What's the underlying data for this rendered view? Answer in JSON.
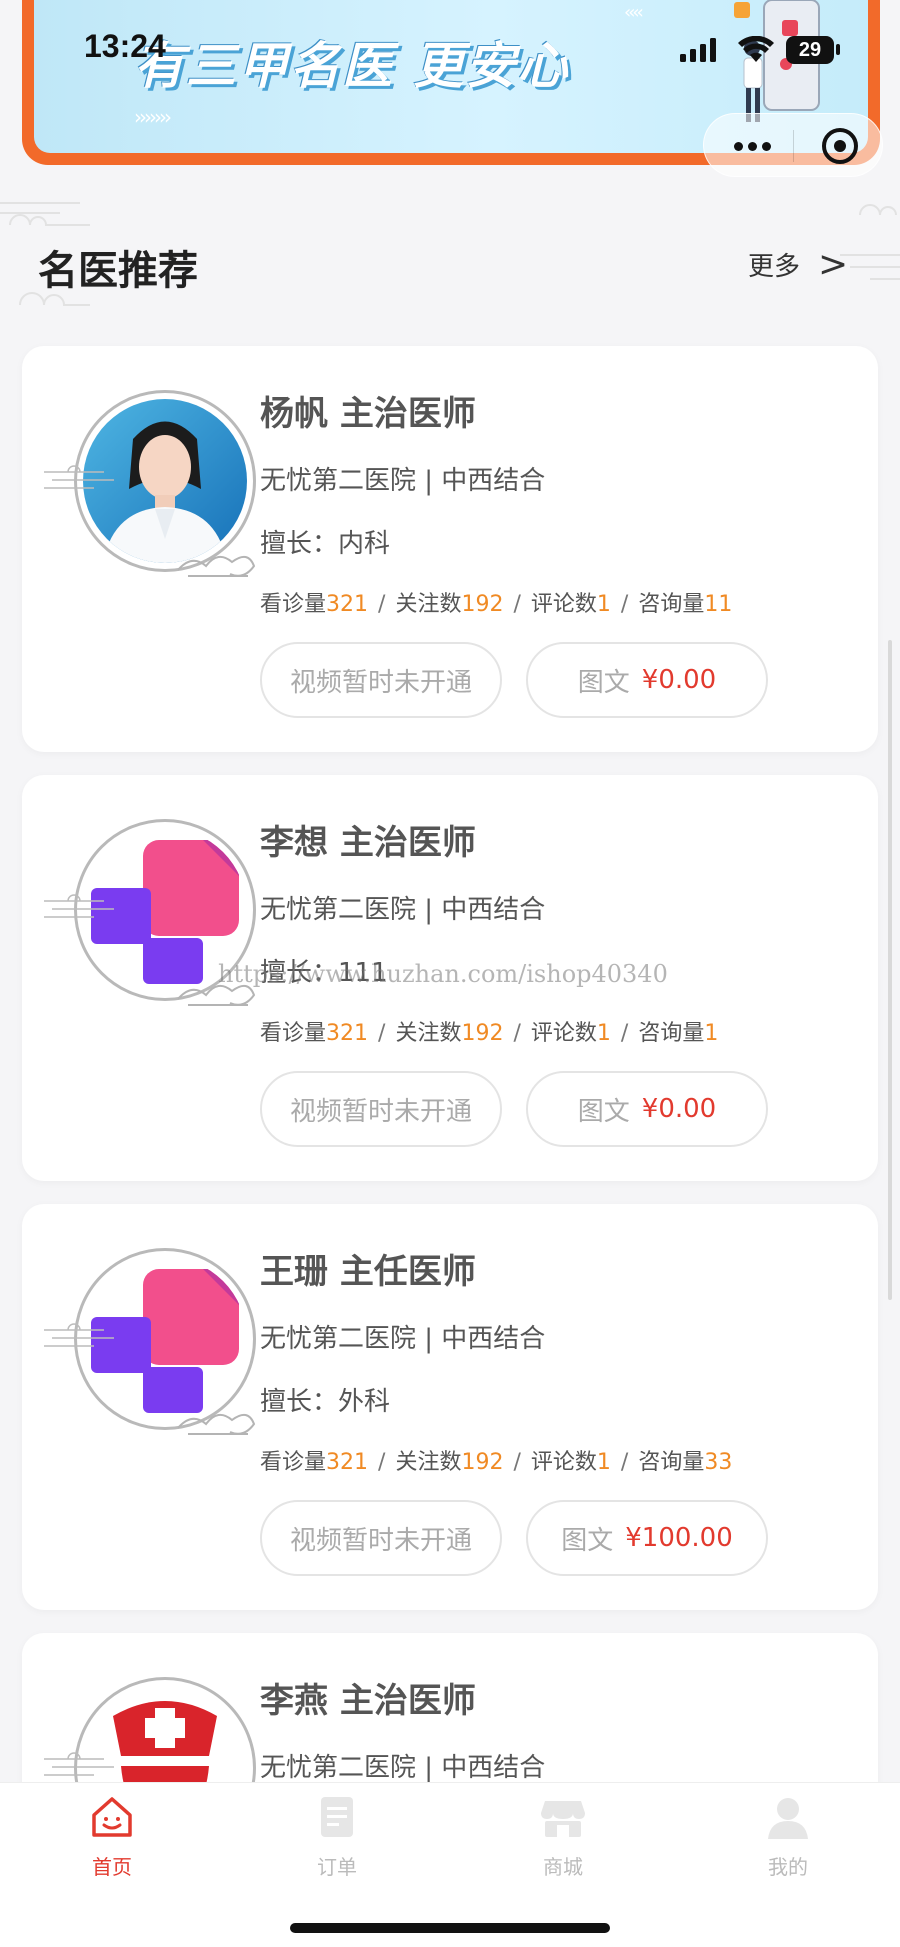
{
  "status_bar": {
    "time": "13:24",
    "battery": "29"
  },
  "banner": {
    "slogan": "有三甲名医 更安心",
    "chevrons": "›››››››",
    "chevrons_small": "‹‹‹‹"
  },
  "section": {
    "title": "名医推荐",
    "more_label": "更多",
    "more_icon": "chevron-right-icon"
  },
  "watermark": "https://www.huzhan.com/ishop40340",
  "colors": {
    "accent": "#e23a2e",
    "stat_number": "#f08a24",
    "banner_border": "#f26a2a"
  },
  "doctors": [
    {
      "name": "杨帆 主治医师",
      "hospital": "无忧第二医院 | 中西结合",
      "specialty": "擅长：内科",
      "stats": {
        "visits_label": "看诊量",
        "visits": "321",
        "follows_label": "关注数",
        "follows": "192",
        "reviews_label": "评论数",
        "reviews": "1",
        "consults_label": "咨询量",
        "consults": "11",
        "sep": "/"
      },
      "video_label": "视频暂时未开通",
      "text_label": "图文",
      "text_price": "¥0.00",
      "avatar": "doctor-photo"
    },
    {
      "name": "李想 主治医师",
      "hospital": "无忧第二医院 | 中西结合",
      "specialty": "擅长：111",
      "stats": {
        "visits_label": "看诊量",
        "visits": "321",
        "follows_label": "关注数",
        "follows": "192",
        "reviews_label": "评论数",
        "reviews": "1",
        "consults_label": "咨询量",
        "consults": "1",
        "sep": "/"
      },
      "video_label": "视频暂时未开通",
      "text_label": "图文",
      "text_price": "¥0.00",
      "avatar": "medical-cross-logo"
    },
    {
      "name": "王珊 主任医师",
      "hospital": "无忧第二医院 | 中西结合",
      "specialty": "擅长：外科",
      "stats": {
        "visits_label": "看诊量",
        "visits": "321",
        "follows_label": "关注数",
        "follows": "192",
        "reviews_label": "评论数",
        "reviews": "1",
        "consults_label": "咨询量",
        "consults": "33",
        "sep": "/"
      },
      "video_label": "视频暂时未开通",
      "text_label": "图文",
      "text_price": "¥100.00",
      "avatar": "medical-cross-logo"
    },
    {
      "name": "李燕 主治医师",
      "hospital": "无忧第二医院 | 中西结合",
      "avatar": "nurse-cap-logo"
    }
  ],
  "tabbar": [
    {
      "label": "首页",
      "icon": "home-icon",
      "active": true
    },
    {
      "label": "订单",
      "icon": "order-icon",
      "active": false
    },
    {
      "label": "商城",
      "icon": "shop-icon",
      "active": false
    },
    {
      "label": "我的",
      "icon": "user-icon",
      "active": false
    }
  ]
}
